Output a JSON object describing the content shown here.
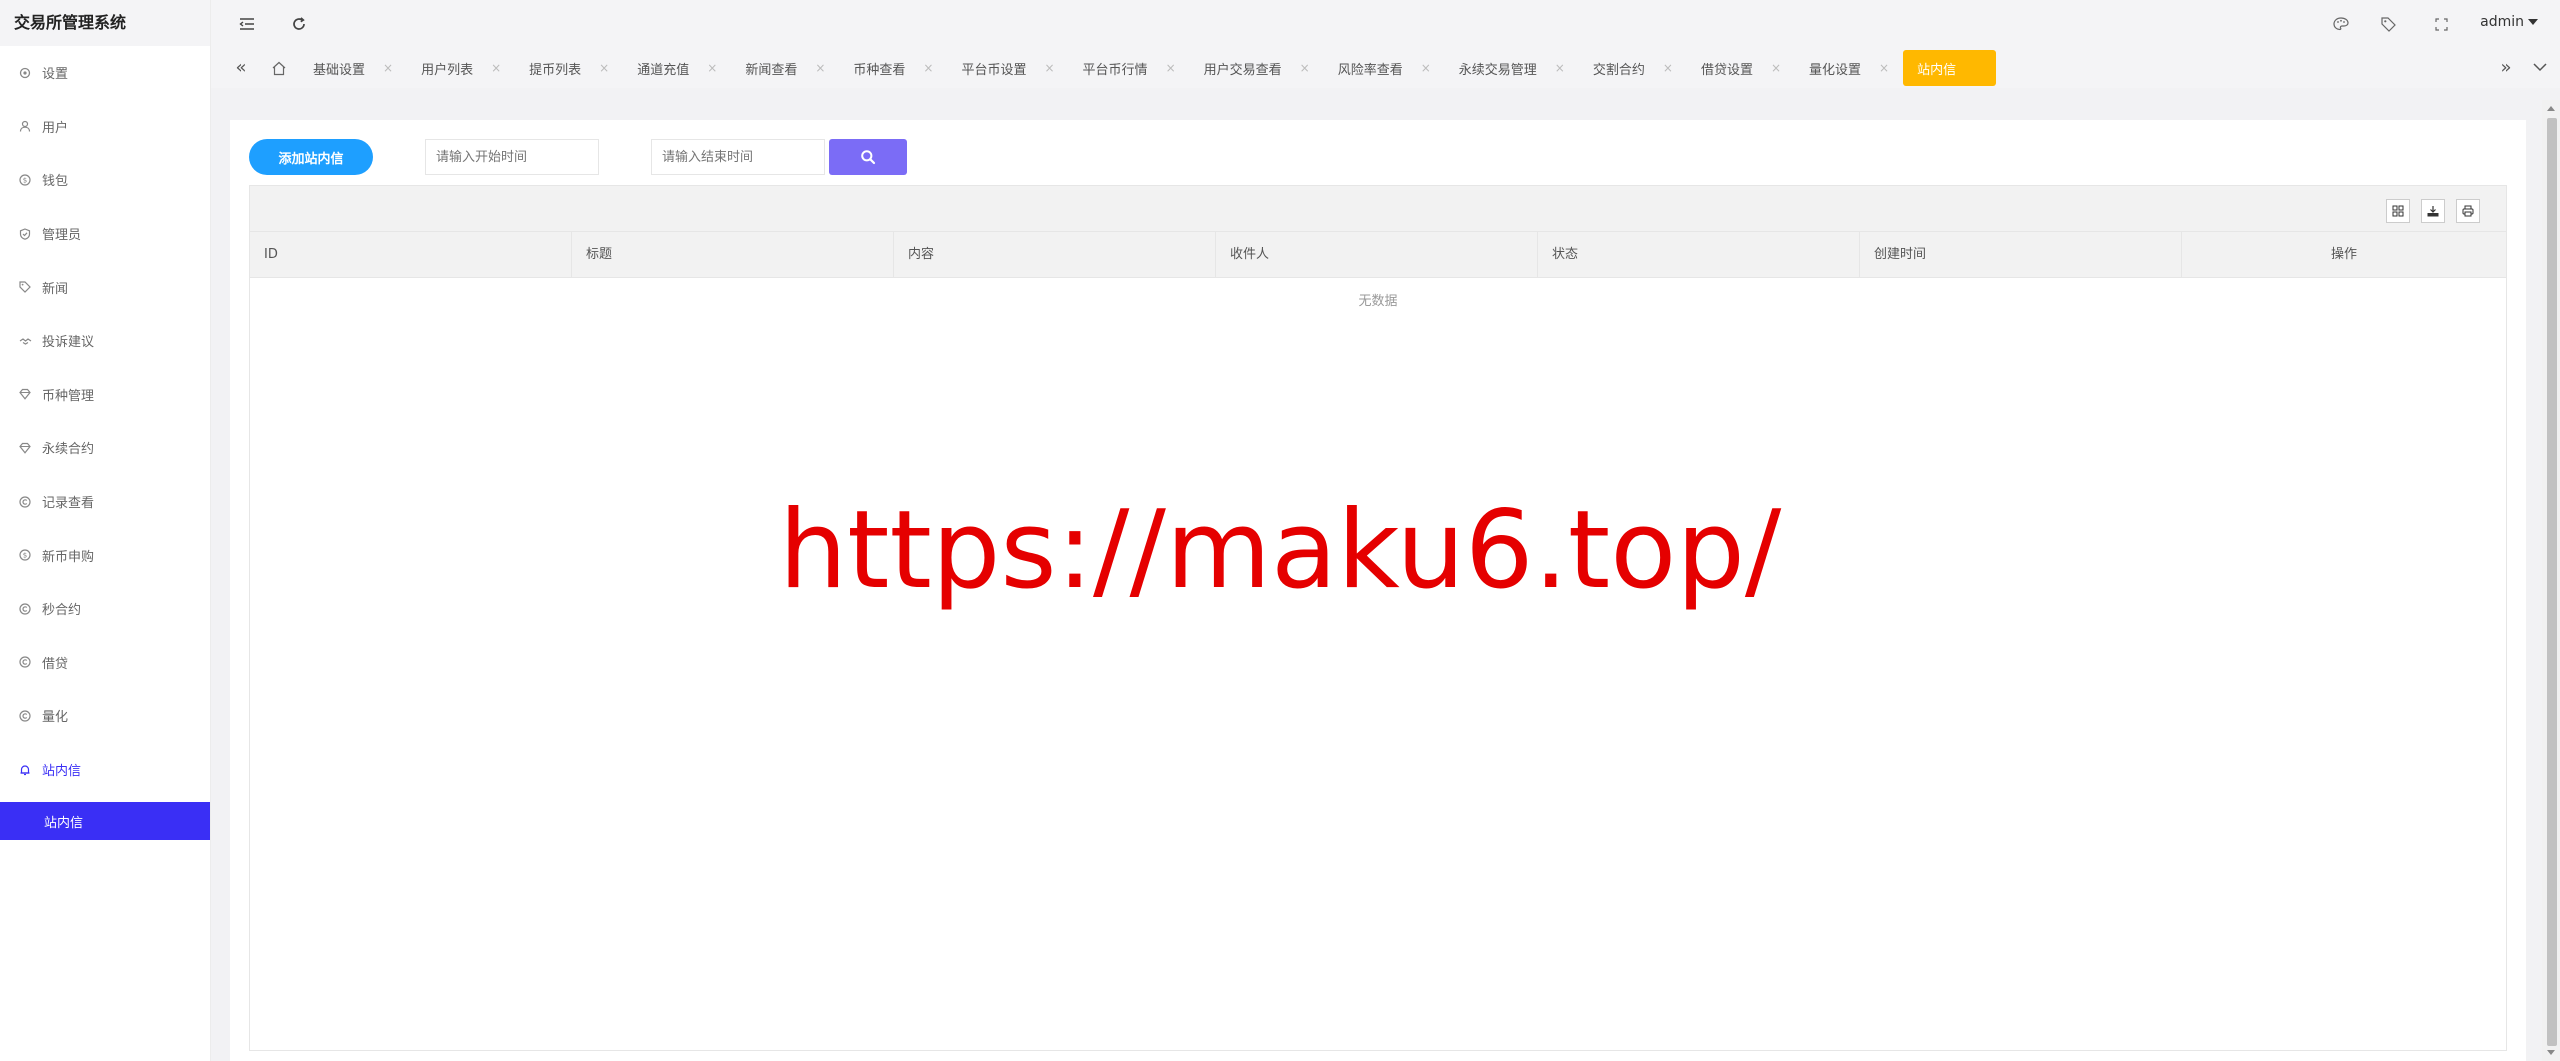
{
  "app": {
    "title": "交易所管理系统"
  },
  "sidebar": {
    "items": [
      {
        "label": "设置",
        "icon": "gear-icon"
      },
      {
        "label": "用户",
        "icon": "user-icon"
      },
      {
        "label": "钱包",
        "icon": "coin-icon"
      },
      {
        "label": "管理员",
        "icon": "shield-icon"
      },
      {
        "label": "新闻",
        "icon": "tag-icon"
      },
      {
        "label": "投诉建议",
        "icon": "handshake-icon"
      },
      {
        "label": "币种管理",
        "icon": "diamond-icon"
      },
      {
        "label": "永续合约",
        "icon": "diamond-icon"
      },
      {
        "label": "记录查看",
        "icon": "copyright-icon"
      },
      {
        "label": "新币申购",
        "icon": "coin-icon"
      },
      {
        "label": "秒合约",
        "icon": "copyright-icon"
      },
      {
        "label": "借贷",
        "icon": "copyright-icon"
      },
      {
        "label": "量化",
        "icon": "copyright-icon"
      },
      {
        "label": "站内信",
        "icon": "bell-icon"
      }
    ],
    "sub_active": "站内信"
  },
  "topbar": {
    "user": "admin"
  },
  "tabs": [
    {
      "label": "基础设置"
    },
    {
      "label": "用户列表"
    },
    {
      "label": "提币列表"
    },
    {
      "label": "通道充值"
    },
    {
      "label": "新闻查看"
    },
    {
      "label": "币种查看"
    },
    {
      "label": "平台币设置"
    },
    {
      "label": "平台币行情"
    },
    {
      "label": "用户交易查看"
    },
    {
      "label": "风险率查看"
    },
    {
      "label": "永续交易管理"
    },
    {
      "label": "交割合约"
    },
    {
      "label": "借贷设置"
    },
    {
      "label": "量化设置"
    },
    {
      "label": "站内信"
    }
  ],
  "toolbar": {
    "add_label": "添加站内信",
    "start_placeholder": "请输入开始时间",
    "end_placeholder": "请输入结束时间"
  },
  "table": {
    "columns": [
      "ID",
      "标题",
      "内容",
      "收件人",
      "状态",
      "创建时间",
      "操作"
    ],
    "empty_text": "无数据"
  },
  "watermark": "https://maku6.top/",
  "colors": {
    "accent": "#3a2ff5",
    "active_tab": "#ffb800",
    "add_button": "#1e9fff",
    "search_button": "#7b6cf6",
    "watermark": "#e50000"
  }
}
